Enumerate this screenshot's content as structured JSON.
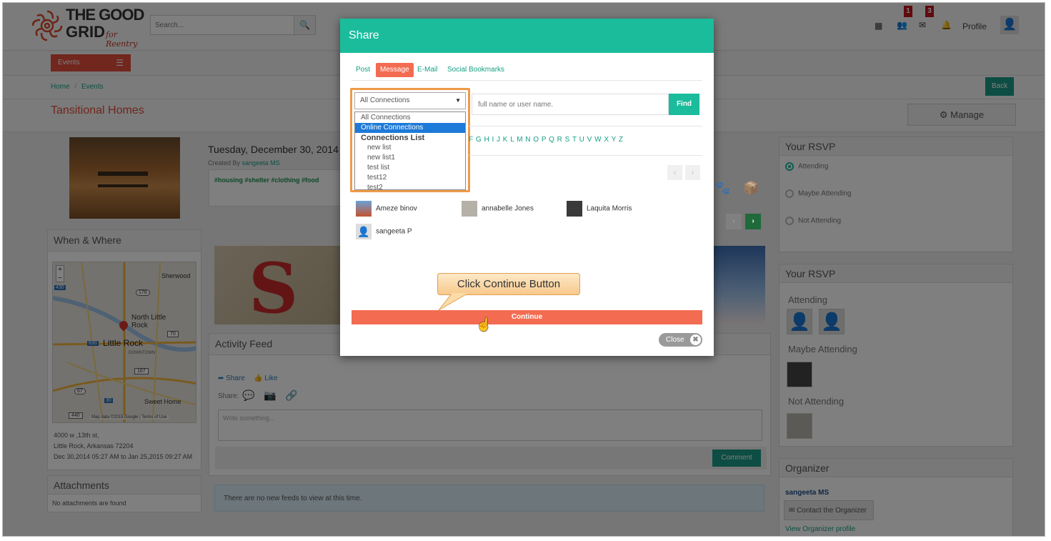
{
  "header": {
    "logo_text_1": "THE GOOD",
    "logo_text_2": "GRID",
    "logo_sub": "for Reentry",
    "search_placeholder": "Search...",
    "friend_badge": "1",
    "mail_badge": "3",
    "profile_label": "Profile"
  },
  "nav": {
    "events_label": "Events",
    "breadcrumb_home": "Home",
    "breadcrumb_sep": "/",
    "breadcrumb_events": "Events",
    "back_label": "Back",
    "page_title": "Tansitional Homes",
    "manage_label": "Manage"
  },
  "event": {
    "date": "Tuesday, December 30, 2014 5:",
    "created_by_prefix": "Created By",
    "creator": "sangeeta MS",
    "tags": "#housing #shelter #clothing #food"
  },
  "when_where": {
    "title": "When & Where",
    "map_labels": [
      "Sherwood",
      "North Little Rock",
      "Little Rock",
      "DOWNTOWN",
      "Sweet Home"
    ],
    "map_roads": [
      "430",
      "176",
      "70",
      "630",
      "167",
      "67",
      "30",
      "440"
    ],
    "map_attribution": "Map data ©2015 Google | Terms of Use",
    "addr1": "4000 w ,13th st,",
    "addr2": "Little Rock, Arkansas 72204",
    "dates": "Dec 30,2014 05:27 AM to Jan 25,2015 09:27 AM"
  },
  "attachments": {
    "title": "Attachments",
    "empty": "No attachments are found"
  },
  "activity": {
    "title": "Activity Feed",
    "share_label": "Share",
    "like_label": "Like",
    "share_prefix": "Share:",
    "placeholder": "Write something...",
    "comment_label": "Comment",
    "empty_feed": "There are no new feeds to view at this time."
  },
  "rsvp1": {
    "title": "Your RSVP",
    "options": [
      "Attending",
      "Maybe Attending",
      "Not Attending"
    ],
    "selected": "Attending"
  },
  "rsvp2": {
    "title": "Your RSVP",
    "attending": "Attending",
    "maybe": "Maybe Attending",
    "not_attending": "Not Attending"
  },
  "organizer": {
    "title": "Organizer",
    "name": "sangeeta MS",
    "contact_label": "Contact the Organizer",
    "profile_link": "View Organizer profile"
  },
  "modal": {
    "title": "Share",
    "tabs": [
      "Post",
      "Message",
      "E-Mail",
      "Social Bookmarks"
    ],
    "active_tab": "Message",
    "select_value": "All Connections",
    "dropdown": [
      {
        "label": "All Connections",
        "kind": "item"
      },
      {
        "label": "Online Connections",
        "kind": "selected"
      },
      {
        "label": "Connections List",
        "kind": "group"
      },
      {
        "label": "new list",
        "kind": "sub"
      },
      {
        "label": "new list1",
        "kind": "sub"
      },
      {
        "label": "test list",
        "kind": "sub"
      },
      {
        "label": "test12",
        "kind": "sub"
      },
      {
        "label": "test2",
        "kind": "sub"
      }
    ],
    "search_placeholder": "full name or user name.",
    "find_label": "Find",
    "letters": "F G H I J K L M N O P Q R S T U V W X Y Z",
    "people": [
      "Ameze binov",
      "annabelle Jones",
      "Laquita Morris",
      "sangeeta P"
    ],
    "callout": "Click Continue Button",
    "continue_label": "Continue",
    "close_label": "Close"
  },
  "colors": {
    "teal": "#1abc9c",
    "coral": "#f36c52",
    "dark_green": "#1a8f4a"
  }
}
